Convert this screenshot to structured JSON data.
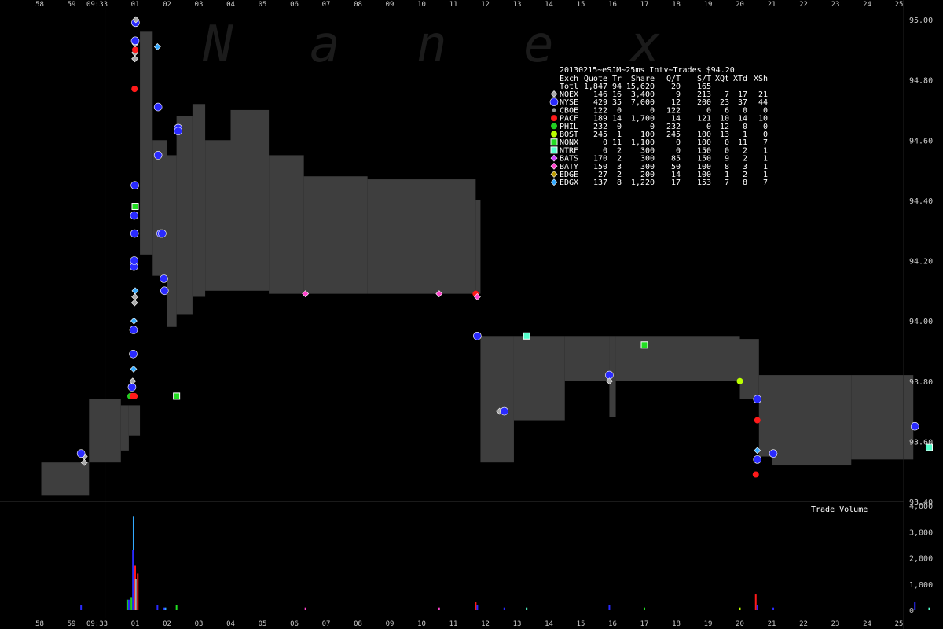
{
  "chart_data": {
    "type": "line",
    "watermark": [
      "N",
      "a",
      "n",
      "e",
      "x"
    ],
    "title": "20130215~eSJM~25ms Intv~Trades $94.20",
    "x_ticks": [
      "58",
      "59",
      "09:33",
      "01",
      "02",
      "03",
      "04",
      "05",
      "06",
      "07",
      "08",
      "09",
      "10",
      "11",
      "12",
      "13",
      "14",
      "15",
      "16",
      "17",
      "18",
      "19",
      "20",
      "21",
      "22",
      "23",
      "24",
      "25"
    ],
    "x_range": [
      -3,
      25
    ],
    "price_axis": {
      "ticks": [
        "95.00",
        "94.80",
        "94.60",
        "94.40",
        "94.20",
        "94.00",
        "93.80",
        "93.60",
        "93.40"
      ],
      "ylim": [
        93.4,
        95.0
      ]
    },
    "volume_axis": {
      "label": "Trade Volume",
      "ticks": [
        "4,000",
        "3,000",
        "2,000",
        "1,000",
        "0"
      ],
      "ylim": [
        0,
        4000
      ]
    },
    "start_time_marker": "09:33",
    "legend": {
      "header": [
        "Exch",
        "Quote",
        "Tr",
        "Share",
        "Q/T",
        "S/T",
        "XQt",
        "XTd",
        "XSh"
      ],
      "total": [
        "Totl",
        "1,847",
        "94",
        "15,620",
        "20",
        "165",
        "",
        "",
        ""
      ],
      "rows": [
        {
          "exch": "NQEX",
          "quote": "146",
          "tr": "16",
          "share": "3,400",
          "qt": "9",
          "st": "213",
          "xqt": "7",
          "xtd": "17",
          "xsh": "21",
          "color": "#aaaaaa",
          "marker": "diamond"
        },
        {
          "exch": "NYSE",
          "quote": "429",
          "tr": "35",
          "share": "7,000",
          "qt": "12",
          "st": "200",
          "xqt": "23",
          "xtd": "37",
          "xsh": "44",
          "color": "#2a2aff",
          "marker": "circle-large"
        },
        {
          "exch": "CBOE",
          "quote": "122",
          "tr": "0",
          "share": "0",
          "qt": "122",
          "st": "0",
          "xqt": "6",
          "xtd": "0",
          "xsh": "0",
          "color": "#999999",
          "marker": "circle-small"
        },
        {
          "exch": "PACF",
          "quote": "189",
          "tr": "14",
          "share": "1,700",
          "qt": "14",
          "st": "121",
          "xqt": "10",
          "xtd": "14",
          "xsh": "10",
          "color": "#ff1a1a",
          "marker": "circle"
        },
        {
          "exch": "PHIL",
          "quote": "232",
          "tr": "0",
          "share": "0",
          "qt": "232",
          "st": "0",
          "xqt": "12",
          "xtd": "0",
          "xsh": "0",
          "color": "#22cc22",
          "marker": "circle"
        },
        {
          "exch": "BOST",
          "quote": "245",
          "tr": "1",
          "share": "100",
          "qt": "245",
          "st": "100",
          "xqt": "13",
          "xtd": "1",
          "xsh": "0",
          "color": "#bbff00",
          "marker": "circle"
        },
        {
          "exch": "NQNX",
          "quote": "0",
          "tr": "11",
          "share": "1,100",
          "qt": "0",
          "st": "100",
          "xqt": "0",
          "xtd": "11",
          "xsh": "7",
          "color": "#22dd22",
          "marker": "square"
        },
        {
          "exch": "NTRF",
          "quote": "0",
          "tr": "2",
          "share": "300",
          "qt": "0",
          "st": "150",
          "xqt": "0",
          "xtd": "2",
          "xsh": "1",
          "color": "#55ffcc",
          "marker": "square"
        },
        {
          "exch": "BATS",
          "quote": "170",
          "tr": "2",
          "share": "300",
          "qt": "85",
          "st": "150",
          "xqt": "9",
          "xtd": "2",
          "xsh": "1",
          "color": "#cc44ff",
          "marker": "diamond"
        },
        {
          "exch": "BATY",
          "quote": "150",
          "tr": "3",
          "share": "300",
          "qt": "50",
          "st": "100",
          "xqt": "8",
          "xtd": "3",
          "xsh": "1",
          "color": "#ff44cc",
          "marker": "diamond"
        },
        {
          "exch": "EDGE",
          "quote": "27",
          "tr": "2",
          "share": "200",
          "qt": "14",
          "st": "100",
          "xqt": "1",
          "xtd": "2",
          "xsh": "1",
          "color": "#bb9900",
          "marker": "diamond"
        },
        {
          "exch": "EDGX",
          "quote": "137",
          "tr": "8",
          "share": "1,220",
          "qt": "17",
          "st": "153",
          "xqt": "7",
          "xtd": "8",
          "xsh": "7",
          "color": "#33aaff",
          "marker": "diamond"
        }
      ]
    },
    "nbbo_band": [
      {
        "x0": -2.95,
        "x1": -1.45,
        "bid": 93.42,
        "ask": 93.53
      },
      {
        "x0": -1.45,
        "x1": -0.45,
        "bid": 93.53,
        "ask": 93.74
      },
      {
        "x0": -0.45,
        "x1": -0.2,
        "bid": 93.57,
        "ask": 93.72
      },
      {
        "x0": -0.2,
        "x1": 0.15,
        "bid": 93.62,
        "ask": 93.72
      },
      {
        "x0": 0.15,
        "x1": 0.55,
        "bid": 94.22,
        "ask": 94.96
      },
      {
        "x0": 0.55,
        "x1": 1.0,
        "bid": 94.15,
        "ask": 94.6
      },
      {
        "x0": 1.0,
        "x1": 1.3,
        "bid": 93.98,
        "ask": 94.55
      },
      {
        "x0": 1.3,
        "x1": 1.8,
        "bid": 94.02,
        "ask": 94.68
      },
      {
        "x0": 1.8,
        "x1": 2.2,
        "bid": 94.08,
        "ask": 94.72
      },
      {
        "x0": 2.2,
        "x1": 3.0,
        "bid": 94.1,
        "ask": 94.6
      },
      {
        "x0": 3.0,
        "x1": 4.2,
        "bid": 94.1,
        "ask": 94.7
      },
      {
        "x0": 4.2,
        "x1": 5.3,
        "bid": 94.09,
        "ask": 94.55
      },
      {
        "x0": 5.3,
        "x1": 7.3,
        "bid": 94.09,
        "ask": 94.48
      },
      {
        "x0": 7.3,
        "x1": 10.7,
        "bid": 94.09,
        "ask": 94.47
      },
      {
        "x0": 10.7,
        "x1": 10.85,
        "bid": 94.09,
        "ask": 94.4
      },
      {
        "x0": 10.85,
        "x1": 11.9,
        "bid": 93.53,
        "ask": 93.95
      },
      {
        "x0": 11.9,
        "x1": 13.5,
        "bid": 93.67,
        "ask": 93.95
      },
      {
        "x0": 13.5,
        "x1": 14.9,
        "bid": 93.8,
        "ask": 93.95
      },
      {
        "x0": 14.9,
        "x1": 15.1,
        "bid": 93.68,
        "ask": 93.95
      },
      {
        "x0": 15.1,
        "x1": 19.0,
        "bid": 93.8,
        "ask": 93.95
      },
      {
        "x0": 19.0,
        "x1": 19.6,
        "bid": 93.74,
        "ask": 93.94
      },
      {
        "x0": 19.6,
        "x1": 20.0,
        "bid": 93.55,
        "ask": 93.82
      },
      {
        "x0": 20.0,
        "x1": 22.5,
        "bid": 93.52,
        "ask": 93.82
      },
      {
        "x0": 22.5,
        "x1": 24.45,
        "bid": 93.54,
        "ask": 93.82
      }
    ],
    "quotes": [
      {
        "exch": "NQEX",
        "x": -1.6,
        "y": 93.53
      },
      {
        "exch": "NQEX",
        "x": -1.6,
        "y": 93.55
      },
      {
        "exch": "NYSE",
        "x": -1.7,
        "y": 93.56
      },
      {
        "exch": "PHIL",
        "x": -0.15,
        "y": 93.75
      },
      {
        "exch": "PACF",
        "x": -0.08,
        "y": 93.75
      },
      {
        "exch": "PACF",
        "x": -0.02,
        "y": 93.75
      },
      {
        "exch": "NYSE",
        "x": -0.1,
        "y": 93.78
      },
      {
        "exch": "NQEX",
        "x": -0.08,
        "y": 93.8
      },
      {
        "exch": "EDGX",
        "x": -0.05,
        "y": 93.84
      },
      {
        "exch": "NYSE",
        "x": -0.06,
        "y": 93.89
      },
      {
        "exch": "NYSE",
        "x": -0.05,
        "y": 93.97
      },
      {
        "exch": "EDGX",
        "x": -0.04,
        "y": 94.0
      },
      {
        "exch": "NQEX",
        "x": -0.02,
        "y": 94.06
      },
      {
        "exch": "NQEX",
        "x": -0.01,
        "y": 94.08
      },
      {
        "exch": "EDGX",
        "x": 0.0,
        "y": 94.1
      },
      {
        "exch": "NYSE",
        "x": -0.04,
        "y": 94.18
      },
      {
        "exch": "NYSE",
        "x": -0.03,
        "y": 94.2
      },
      {
        "exch": "NYSE",
        "x": -0.02,
        "y": 94.29
      },
      {
        "exch": "NYSE",
        "x": -0.03,
        "y": 94.35
      },
      {
        "exch": "NQNX",
        "x": 0.0,
        "y": 94.38
      },
      {
        "exch": "NYSE",
        "x": -0.01,
        "y": 94.45
      },
      {
        "exch": "PACF",
        "x": -0.02,
        "y": 94.77
      },
      {
        "exch": "NQEX",
        "x": -0.01,
        "y": 94.87
      },
      {
        "exch": "NQEX",
        "x": -0.01,
        "y": 94.89
      },
      {
        "exch": "PACF",
        "x": 0.0,
        "y": 94.9
      },
      {
        "exch": "NQEX",
        "x": 0.0,
        "y": 94.92
      },
      {
        "exch": "NYSE",
        "x": 0.0,
        "y": 94.93
      },
      {
        "exch": "NYSE",
        "x": 0.01,
        "y": 94.99
      },
      {
        "exch": "NQEX",
        "x": 0.02,
        "y": 95.0
      },
      {
        "exch": "EDGX",
        "x": 0.7,
        "y": 94.91
      },
      {
        "exch": "NYSE",
        "x": 0.72,
        "y": 94.71
      },
      {
        "exch": "NYSE",
        "x": 0.72,
        "y": 94.55
      },
      {
        "exch": "NYSE",
        "x": 0.8,
        "y": 94.29
      },
      {
        "exch": "NYSE",
        "x": 0.85,
        "y": 94.29
      },
      {
        "exch": "NYSE",
        "x": 0.9,
        "y": 94.14
      },
      {
        "exch": "NYSE",
        "x": 0.92,
        "y": 94.1
      },
      {
        "exch": "NQNX",
        "x": 1.3,
        "y": 93.75
      },
      {
        "exch": "NYSE",
        "x": 1.35,
        "y": 94.64
      },
      {
        "exch": "NYSE",
        "x": 1.35,
        "y": 94.63
      },
      {
        "exch": "BATY",
        "x": 5.35,
        "y": 94.09
      },
      {
        "exch": "BATY",
        "x": 9.55,
        "y": 94.09
      },
      {
        "exch": "PACF",
        "x": 10.7,
        "y": 94.09
      },
      {
        "exch": "BATY",
        "x": 10.75,
        "y": 94.08
      },
      {
        "exch": "NYSE",
        "x": 10.75,
        "y": 93.95
      },
      {
        "exch": "NQEX",
        "x": 11.45,
        "y": 93.7
      },
      {
        "exch": "NYSE",
        "x": 11.6,
        "y": 93.7
      },
      {
        "exch": "NTRF",
        "x": 12.3,
        "y": 93.95
      },
      {
        "exch": "NYSE",
        "x": 14.9,
        "y": 93.82
      },
      {
        "exch": "NQEX",
        "x": 14.9,
        "y": 93.8
      },
      {
        "exch": "NQNX",
        "x": 16.0,
        "y": 93.92
      },
      {
        "exch": "BOST",
        "x": 19.0,
        "y": 93.8
      },
      {
        "exch": "NYSE",
        "x": 19.55,
        "y": 93.74
      },
      {
        "exch": "PACF",
        "x": 19.55,
        "y": 93.67
      },
      {
        "exch": "EDGX",
        "x": 19.55,
        "y": 93.57
      },
      {
        "exch": "NYSE",
        "x": 19.55,
        "y": 93.54
      },
      {
        "exch": "PACF",
        "x": 19.5,
        "y": 93.49
      },
      {
        "exch": "NYSE",
        "x": 20.05,
        "y": 93.56
      },
      {
        "exch": "NYSE",
        "x": 24.5,
        "y": 93.65
      },
      {
        "exch": "NTRF",
        "x": 24.95,
        "y": 93.58
      }
    ],
    "volume_bars": [
      {
        "exch": "NYSE",
        "x": -1.7,
        "v": 200
      },
      {
        "exch": "NYSE",
        "x": -0.2,
        "v": 400
      },
      {
        "exch": "EDGX",
        "x": -0.05,
        "v": 3600
      },
      {
        "exch": "NYSE",
        "x": -0.07,
        "v": 2300
      },
      {
        "exch": "PACF",
        "x": 0.0,
        "v": 1700
      },
      {
        "exch": "NQEX",
        "x": 0.02,
        "v": 1200
      },
      {
        "exch": "PACF",
        "x": 0.08,
        "v": 1400
      },
      {
        "exch": "PHIL",
        "x": -0.12,
        "v": 500
      },
      {
        "exch": "NQNX",
        "x": -0.25,
        "v": 400
      },
      {
        "exch": "NYSE",
        "x": 0.7,
        "v": 200
      },
      {
        "exch": "NYSE",
        "x": 0.9,
        "v": 100
      },
      {
        "exch": "EDGX",
        "x": 0.95,
        "v": 100
      },
      {
        "exch": "NQNX",
        "x": 1.3,
        "v": 200
      },
      {
        "exch": "BATY",
        "x": 5.35,
        "v": 100
      },
      {
        "exch": "BATY",
        "x": 9.55,
        "v": 100
      },
      {
        "exch": "PACF",
        "x": 10.7,
        "v": 300
      },
      {
        "exch": "NYSE",
        "x": 10.75,
        "v": 200
      },
      {
        "exch": "NYSE",
        "x": 11.6,
        "v": 100
      },
      {
        "exch": "NTRF",
        "x": 12.3,
        "v": 100
      },
      {
        "exch": "NYSE",
        "x": 14.9,
        "v": 200
      },
      {
        "exch": "NQNX",
        "x": 16.0,
        "v": 100
      },
      {
        "exch": "BOST",
        "x": 19.0,
        "v": 100
      },
      {
        "exch": "PACF",
        "x": 19.5,
        "v": 600
      },
      {
        "exch": "NYSE",
        "x": 19.55,
        "v": 200
      },
      {
        "exch": "NYSE",
        "x": 20.05,
        "v": 100
      },
      {
        "exch": "NYSE",
        "x": 24.5,
        "v": 300
      },
      {
        "exch": "NTRF",
        "x": 24.95,
        "v": 100
      }
    ]
  }
}
